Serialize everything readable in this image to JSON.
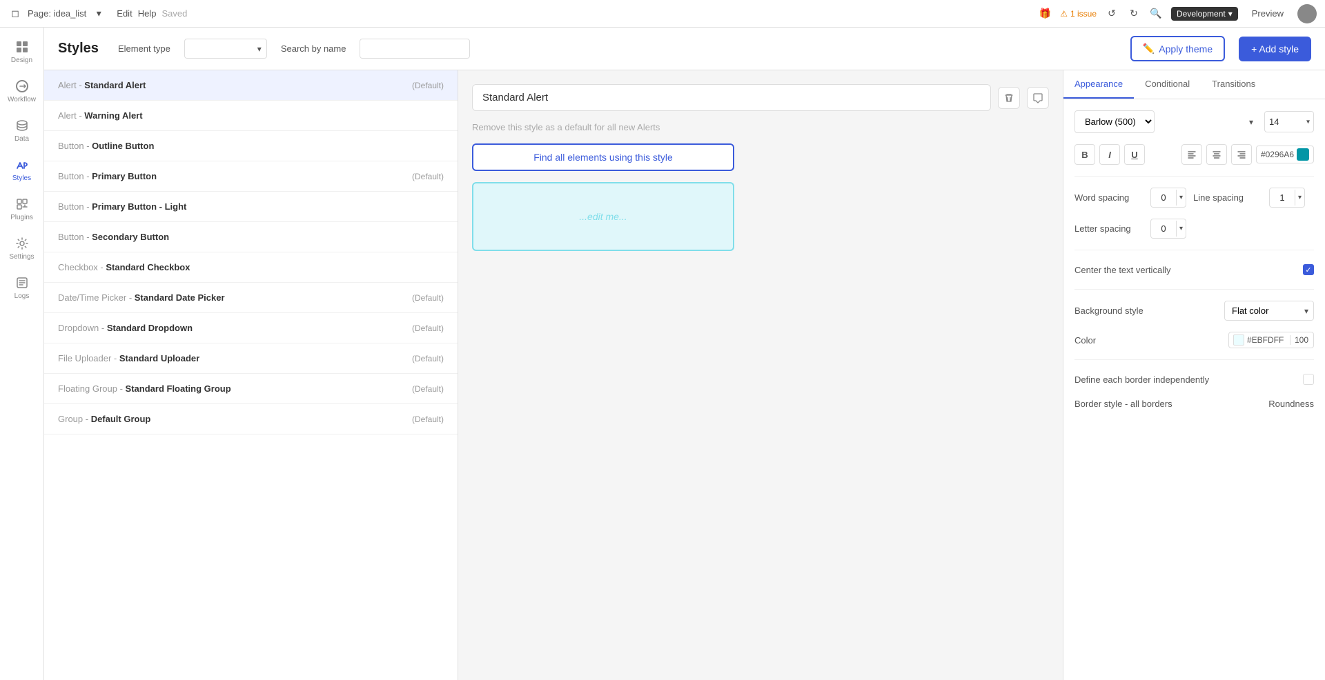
{
  "topbar": {
    "page_label": "Page: idea_list",
    "edit_label": "Edit",
    "help_label": "Help",
    "saved_label": "Saved",
    "warning_label": "1 issue",
    "dev_label": "Development",
    "preview_label": "Preview"
  },
  "header": {
    "title": "Styles",
    "element_type_label": "Element type",
    "element_type_placeholder": "",
    "search_label": "Search by name",
    "search_placeholder": "",
    "apply_theme_label": "Apply theme",
    "add_style_label": "+ Add style"
  },
  "styles_list": {
    "items": [
      {
        "type": "Alert - ",
        "name": "Standard Alert",
        "default": "(Default)",
        "active": true
      },
      {
        "type": "Alert - ",
        "name": "Warning Alert",
        "default": "",
        "active": false
      },
      {
        "type": "Button - ",
        "name": "Outline Button",
        "default": "",
        "active": false
      },
      {
        "type": "Button - ",
        "name": "Primary Button",
        "default": "(Default)",
        "active": false
      },
      {
        "type": "Button - ",
        "name": "Primary Button - Light",
        "default": "",
        "active": false
      },
      {
        "type": "Button - ",
        "name": "Secondary Button",
        "default": "",
        "active": false
      },
      {
        "type": "Checkbox - ",
        "name": "Standard Checkbox",
        "default": "",
        "active": false
      },
      {
        "type": "Date/Time Picker - ",
        "name": "Standard Date Picker",
        "default": "(Default)",
        "active": false
      },
      {
        "type": "Dropdown - ",
        "name": "Standard Dropdown",
        "default": "(Default)",
        "active": false
      },
      {
        "type": "File Uploader - ",
        "name": "Standard Uploader",
        "default": "(Default)",
        "active": false
      },
      {
        "type": "Floating Group - ",
        "name": "Standard Floating Group",
        "default": "(Default)",
        "active": false
      },
      {
        "type": "Group - ",
        "name": "Default Group",
        "default": "(Default)",
        "active": false
      }
    ]
  },
  "middle_panel": {
    "style_name": "Standard Alert",
    "remove_default_text": "Remove this style as a default for all new Alerts",
    "find_elements_btn": "Find all elements using this style",
    "preview_placeholder": "...edit me..."
  },
  "right_panel": {
    "tabs": [
      {
        "label": "Appearance",
        "active": true
      },
      {
        "label": "Conditional",
        "active": false
      },
      {
        "label": "Transitions",
        "active": false
      }
    ],
    "font": {
      "family": "Barlow (500)",
      "size": "14"
    },
    "format": {
      "bold": "B",
      "italic": "I",
      "underline": "U"
    },
    "alignment": {
      "left": "≡",
      "center": "≡",
      "right": "≡"
    },
    "color_hex": "#0296A6",
    "word_spacing_label": "Word spacing",
    "word_spacing_value": "0",
    "line_spacing_label": "Line spacing",
    "line_spacing_value": "1",
    "letter_spacing_label": "Letter spacing",
    "letter_spacing_value": "0",
    "vertical_center_label": "Center the text vertically",
    "background_style_label": "Background style",
    "background_style_value": "Flat color",
    "color_label": "Color",
    "color_value": "#EBFDFF",
    "color_opacity": "100",
    "define_border_label": "Define each border independently",
    "border_style_label": "Border style - all borders",
    "roundness_label": "Roundness"
  }
}
